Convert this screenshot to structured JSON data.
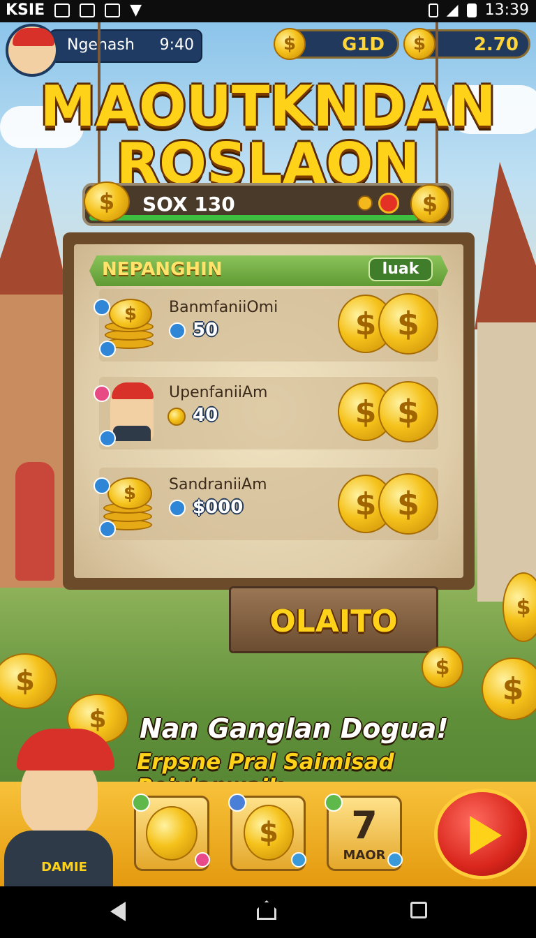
{
  "status_bar": {
    "left_text": "KSIE",
    "time": "13:39"
  },
  "player": {
    "name": "Ngenash",
    "timer": "9:40"
  },
  "currencies": [
    {
      "value": "G1D"
    },
    {
      "value": "2.70"
    }
  ],
  "title": {
    "line1": "MAOUTKNDAN",
    "line2": "ROSLAON"
  },
  "progress": {
    "label": "SOX 130",
    "fraction": 0.92
  },
  "panel": {
    "title": "NEPANGHIN",
    "badge": "luak",
    "rows": [
      {
        "name": "BanmfaniiOmi",
        "value": "50"
      },
      {
        "name": "UpenfaniiAm",
        "value": "40"
      },
      {
        "name": "SandraniiAm",
        "value": "$000"
      }
    ]
  },
  "claim_button": {
    "label": "OLAITO"
  },
  "promo": {
    "headline": "Nan Ganglan Dogua!",
    "subline": "Erpsne Pral Saimisad Reivlanwaik"
  },
  "bottom": {
    "tiles": [
      {
        "icon": "coin-icon"
      },
      {
        "icon": "dollar-coin-icon"
      },
      {
        "number": "7",
        "label": "MAOR"
      }
    ],
    "mascot_shirt": "DAMIE"
  },
  "colors": {
    "gold": "#ffd21a",
    "panel_wood": "#6b4b2a",
    "header_green": "#6fad3e",
    "play_red": "#d9261c"
  }
}
